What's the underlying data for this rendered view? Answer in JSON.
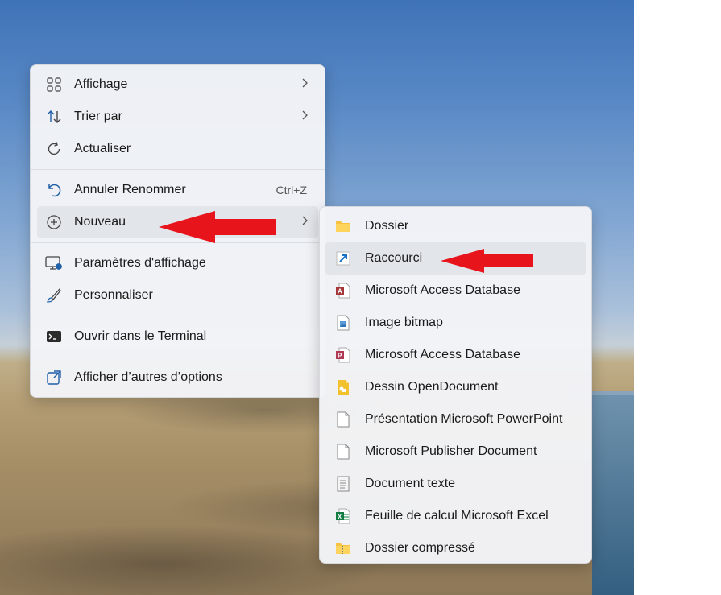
{
  "main_menu": {
    "items": [
      {
        "label": "Affichage",
        "icon": "grid-view-icon",
        "submenu": true
      },
      {
        "label": "Trier par",
        "icon": "sort-arrows-icon",
        "submenu": true
      },
      {
        "label": "Actualiser",
        "icon": "refresh-icon",
        "submenu": false
      },
      {
        "label": "Annuler Renommer",
        "icon": "undo-icon",
        "shortcut": "Ctrl+Z"
      },
      {
        "label": "Nouveau",
        "icon": "plus-circle-icon",
        "submenu": true,
        "highlighted": true
      },
      {
        "label": "Paramètres d'affichage",
        "icon": "display-settings-icon"
      },
      {
        "label": "Personnaliser",
        "icon": "brush-icon"
      },
      {
        "label": "Ouvrir dans le Terminal",
        "icon": "terminal-icon"
      },
      {
        "label": "Afficher d’autres d’options",
        "icon": "more-options-icon"
      }
    ]
  },
  "sub_menu": {
    "items": [
      {
        "label": "Dossier",
        "icon": "folder-icon"
      },
      {
        "label": "Raccourci",
        "icon": "shortcut-icon",
        "highlighted": true
      },
      {
        "label": "Microsoft Access Database",
        "icon": "access-icon"
      },
      {
        "label": "Image bitmap",
        "icon": "bitmap-icon"
      },
      {
        "label": "Microsoft Access Database",
        "icon": "access-icon"
      },
      {
        "label": "Dessin OpenDocument",
        "icon": "opendocument-drawing-icon"
      },
      {
        "label": "Présentation Microsoft PowerPoint",
        "icon": "blank-file-icon"
      },
      {
        "label": "Microsoft Publisher Document",
        "icon": "blank-file-icon"
      },
      {
        "label": "Document texte",
        "icon": "text-document-icon"
      },
      {
        "label": "Feuille de calcul Microsoft Excel",
        "icon": "excel-icon"
      },
      {
        "label": "Dossier compressé",
        "icon": "zip-folder-icon"
      }
    ]
  },
  "colors": {
    "annotation_arrow": "#e8141c",
    "menu_bg": "#f3f4f7",
    "highlight": "#e2e5ea"
  }
}
